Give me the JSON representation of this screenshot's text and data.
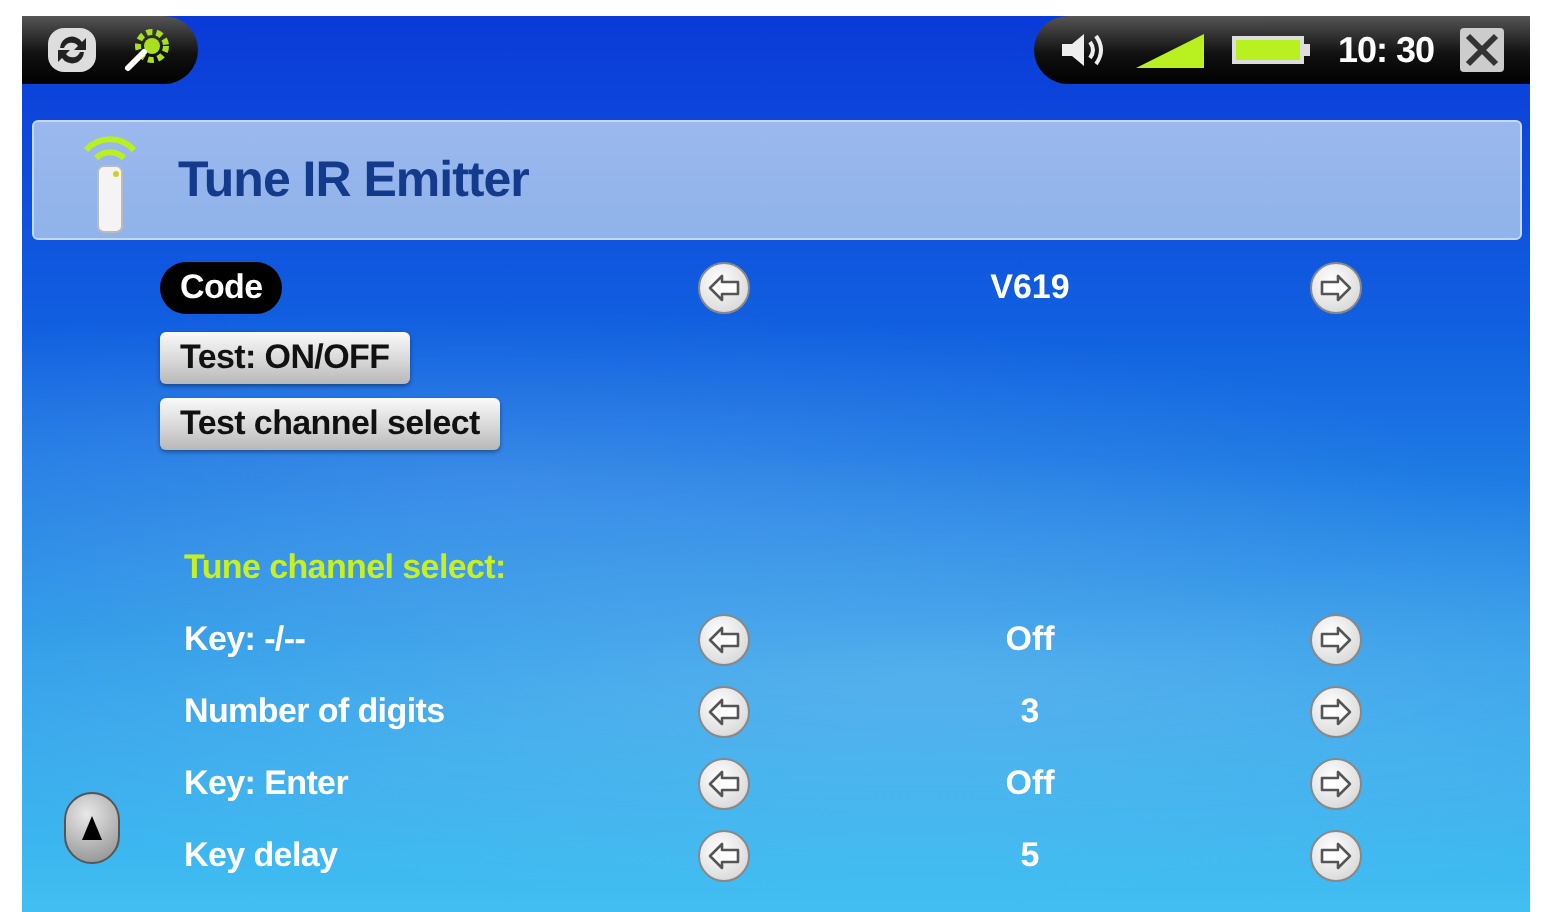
{
  "status_bar": {
    "time": "10: 30"
  },
  "header": {
    "title": "Tune IR Emitter"
  },
  "settings": [
    {
      "kind": "selector",
      "label": "Code",
      "value": "V619",
      "selected": true
    },
    {
      "kind": "button",
      "label": "Test: ON/OFF",
      "selected": false
    },
    {
      "kind": "button",
      "label": "Test channel select",
      "selected": false
    }
  ],
  "tune_section": {
    "heading": "Tune channel select:",
    "rows": [
      {
        "kind": "selector",
        "label": "Key: -/--",
        "value": "Off",
        "selected": false
      },
      {
        "kind": "selector",
        "label": "Number of digits",
        "value": "3",
        "selected": false
      },
      {
        "kind": "selector",
        "label": "Key: Enter",
        "value": "Off",
        "selected": false
      },
      {
        "kind": "selector",
        "label": "Key delay",
        "value": "5",
        "selected": false
      }
    ]
  }
}
